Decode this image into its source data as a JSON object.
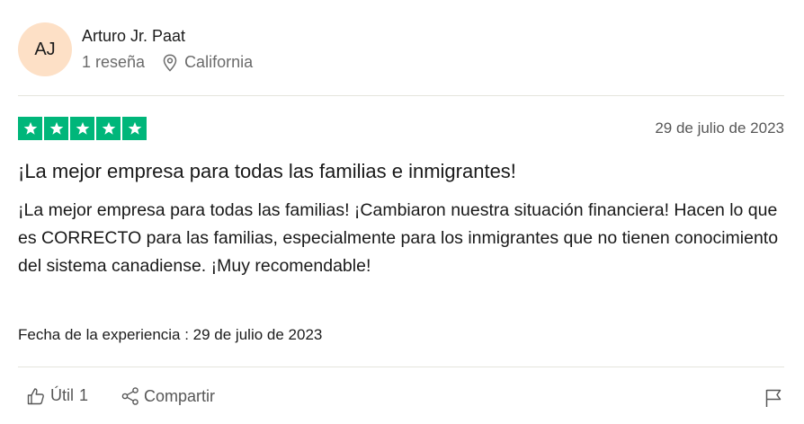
{
  "reviewer": {
    "initials": "AJ",
    "name": "Arturo Jr. Paat",
    "review_count": "1 reseña",
    "location": "California"
  },
  "review": {
    "rating": 5,
    "date": "29 de julio de 2023",
    "title": "¡La mejor empresa para todas las familias e inmigrantes!",
    "body": "¡La mejor empresa para todas las familias! ¡Cambiaron nuestra situación financiera! Hacen lo que es CORRECTO para las familias, especialmente para los inmigrantes que no tienen conocimiento del sistema canadiense. ¡Muy recomendable!",
    "experience_date": "Fecha de la experiencia : 29 de julio de 2023"
  },
  "actions": {
    "useful_label": "Útil",
    "useful_count": "1",
    "share_label": "Compartir"
  },
  "colors": {
    "star_green": "#00b67a",
    "avatar_bg": "#fde0c6"
  }
}
